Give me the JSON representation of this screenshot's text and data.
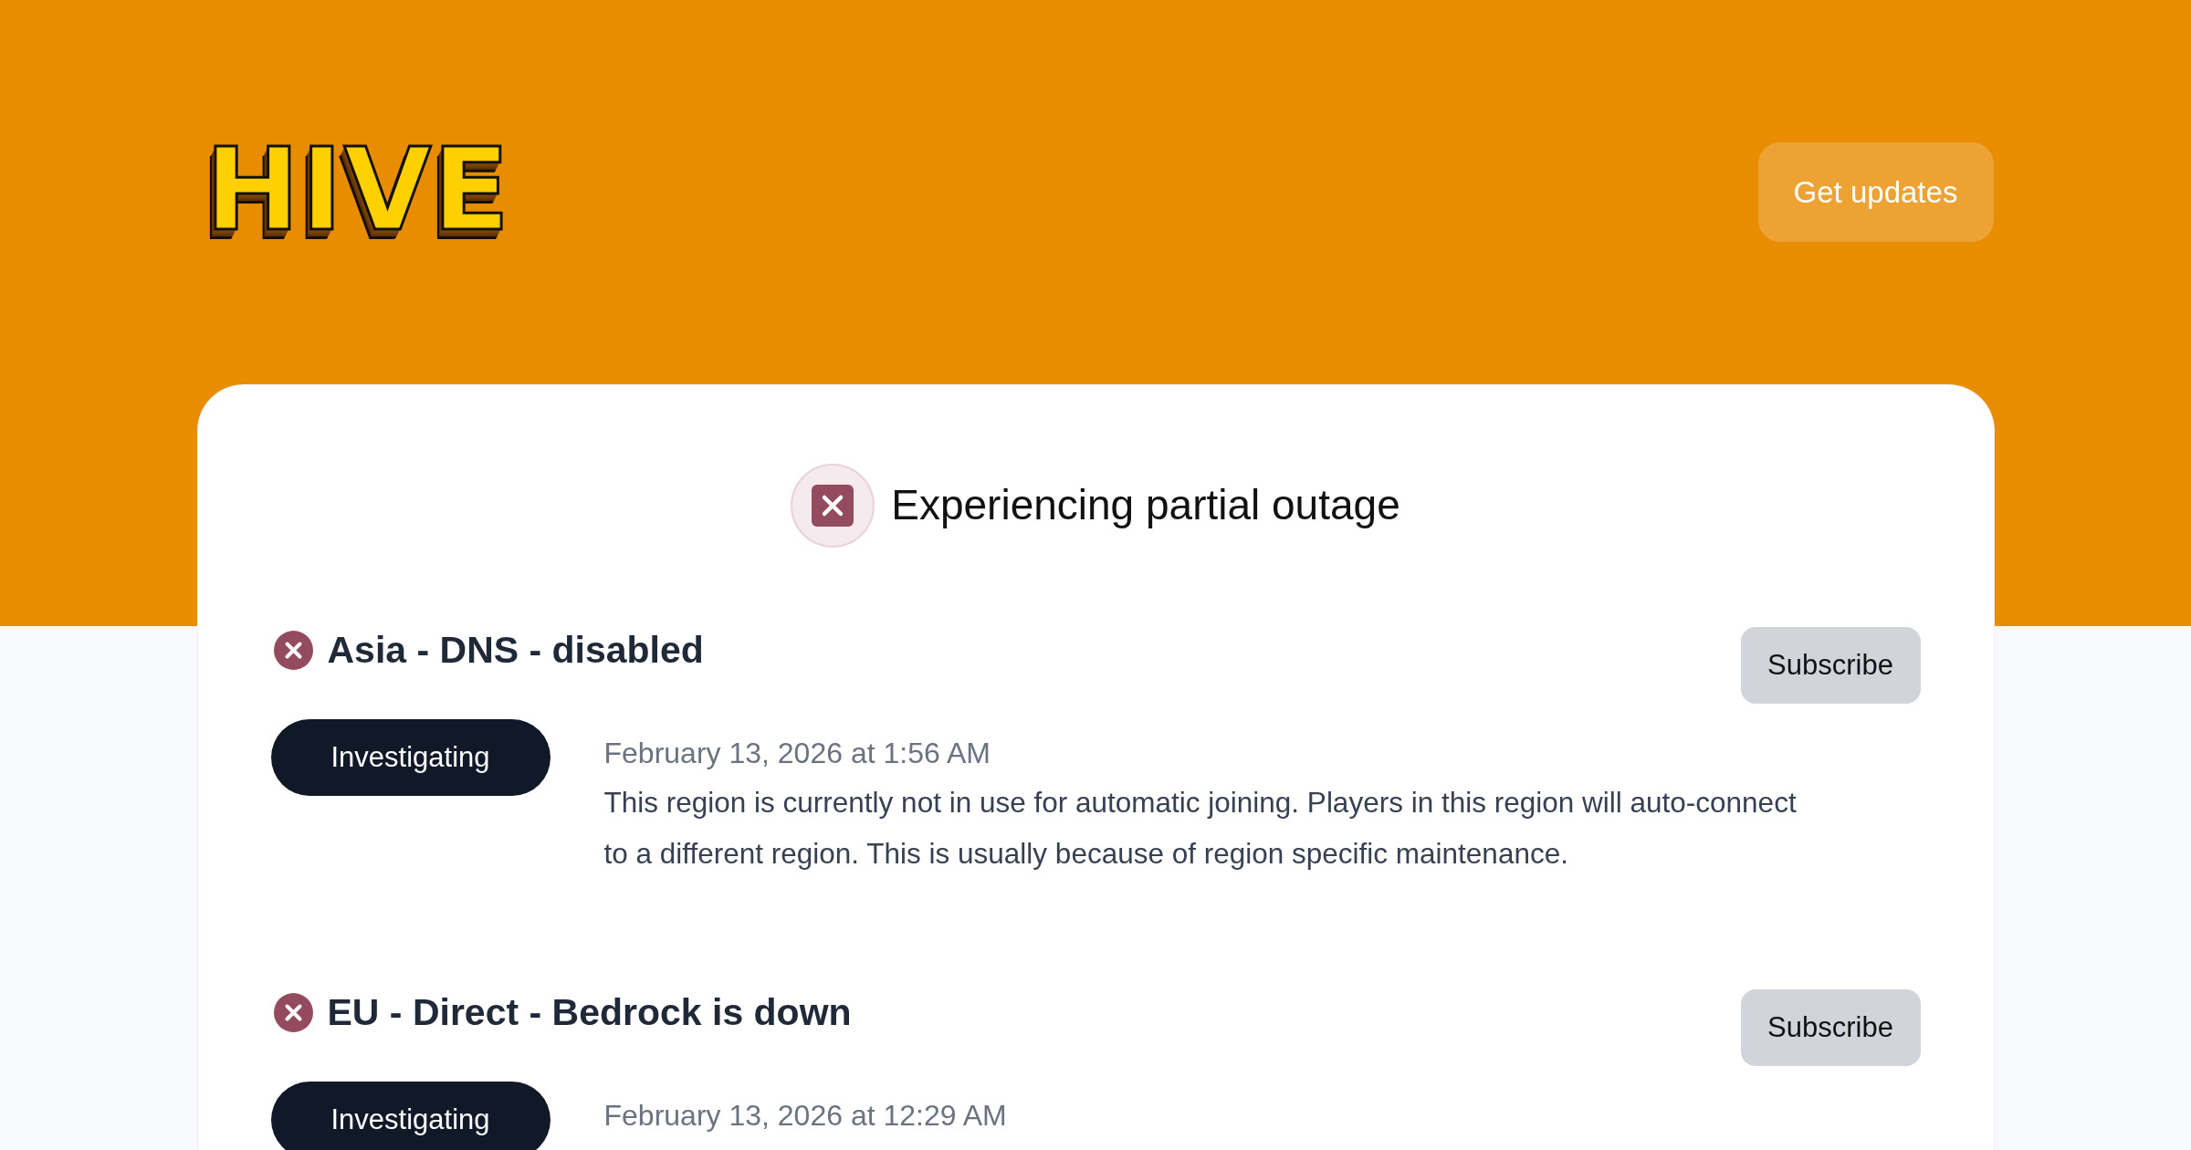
{
  "header": {
    "logo": "HIVE",
    "button": "Get updates"
  },
  "status": {
    "kind": "outage",
    "title": "Experiencing partial outage"
  },
  "incidents": [
    {
      "kind": "outage",
      "title": "Asia - DNS - disabled",
      "button": "Subscribe",
      "badge": "Investigating",
      "time": "February 13, 2026 at 1:56 AM",
      "description": "This region is currently not in use for automatic joining. Players in this region will auto-connect to a different region. This is usually because of region specific maintenance."
    },
    {
      "kind": "outage",
      "title": "EU - Direct - Bedrock is down",
      "button": "Subscribe",
      "badge": "Investigating",
      "time": "February 13, 2026 at 12:29 AM"
    }
  ]
}
